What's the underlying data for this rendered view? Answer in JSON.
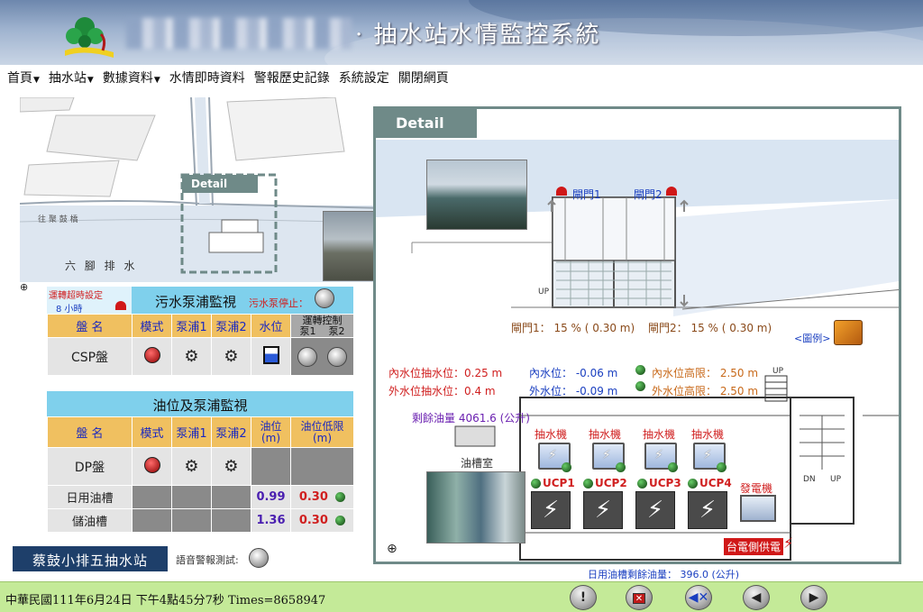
{
  "header": {
    "title": "· 抽水站水情監控系統"
  },
  "menu": {
    "items": [
      {
        "label": "首頁",
        "dropdown": true
      },
      {
        "label": "抽水站",
        "dropdown": true
      },
      {
        "label": "數據資料",
        "dropdown": true
      },
      {
        "label": "水情即時資料",
        "dropdown": false
      },
      {
        "label": "警報歷史記錄",
        "dropdown": false
      },
      {
        "label": "系統設定",
        "dropdown": false
      },
      {
        "label": "關閉網頁",
        "dropdown": false
      }
    ]
  },
  "map": {
    "detail_tag": "Detail",
    "road_label": "往 聚 鼓 橋",
    "area_label": "六 腳 排 水",
    "compass": "N"
  },
  "sewage_panel": {
    "title": "污水泵浦監視",
    "timeout_label": "運轉超時設定",
    "timeout_value": "8 小時",
    "stop_label": "污水泵停止：",
    "headers": [
      "盤  名",
      "模式",
      "泵浦1",
      "泵浦2",
      "水位",
      "運轉控制"
    ],
    "sub_headers": [
      "泵1",
      "泵2"
    ],
    "row_name": "CSP盤"
  },
  "oil_panel": {
    "title": "油位及泵浦監視",
    "headers": [
      "盤  名",
      "模式",
      "泵浦1",
      "泵浦2",
      "油位\n(m)",
      "油位低限\n(m)"
    ],
    "header_oil": "油位",
    "header_oil_unit": "(m)",
    "header_low": "油位低限",
    "header_low_unit": "(m)",
    "rows": [
      {
        "name": "DP盤",
        "oil": "",
        "low": ""
      },
      {
        "name": "日用油槽",
        "oil": "0.99",
        "low": "0.30"
      },
      {
        "name": "儲油槽",
        "oil": "1.36",
        "low": "0.30"
      }
    ]
  },
  "station_button": "蔡鼓小排五抽水站",
  "voice_test_label": "語音警報測試:",
  "detail": {
    "tag": "Detail",
    "gate1_label": "閘門1",
    "gate2_label": "閘門2",
    "up_label": "UP",
    "gate1_status": "閘門1： 15 % ( 0.30 m)",
    "gate2_status": "閘門2： 15 % ( 0.30 m)",
    "legend_label": "<圖例>",
    "inner_pump_level": "內水位抽水位：0.25 m",
    "outer_pump_level": "外水位抽水位：0.4 m",
    "inner_level": "內水位： -0.06 m",
    "outer_level": "外水位： -0.09 m",
    "inner_high": "內水位高限： 2.50 m",
    "outer_high": "外水位高限： 2.50 m",
    "remaining_oil": "剩餘油量 4061.6 (公升)",
    "oil_room": "油槽室",
    "pump_label": "抽水機",
    "ucp_labels": [
      "UCP1",
      "UCP2",
      "UCP3",
      "UCP4"
    ],
    "generator_label": "發電機",
    "power_label": "台電側供電",
    "dn_label": "DN",
    "up2_label": "UP",
    "daily_tank": "日用油槽剩餘油量： 396.0 (公升)"
  },
  "status": {
    "text": "中華民國111年6月24日 下午4點45分7秒 Times=8658947",
    "info_button": "!"
  }
}
